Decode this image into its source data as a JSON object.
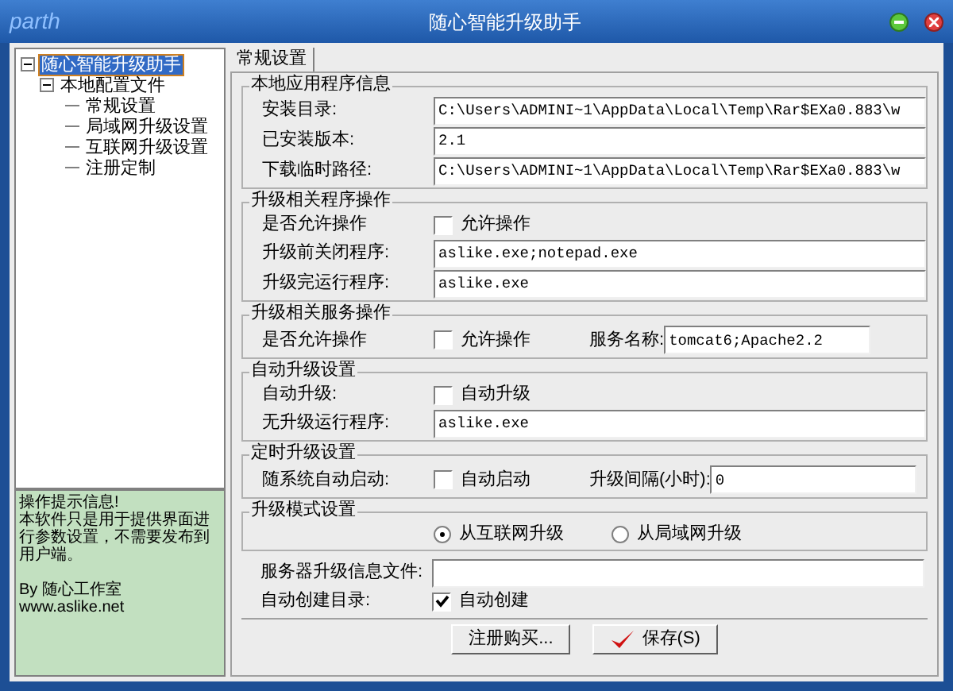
{
  "window": {
    "logo": "parth",
    "title": "随心智能升级助手"
  },
  "tree": [
    {
      "label": "随心智能升级助手",
      "selected": true,
      "expanded": true,
      "children": [
        {
          "label": "本地配置文件",
          "selected": false,
          "expanded": true,
          "children": [
            {
              "label": "常规设置",
              "selected": false
            },
            {
              "label": "局域网升级设置",
              "selected": false
            },
            {
              "label": "互联网升级设置",
              "selected": false
            },
            {
              "label": "注册定制",
              "selected": false
            }
          ]
        }
      ]
    }
  ],
  "tip": {
    "title": "操作提示信息!",
    "body": "本软件只是用于提供界面进行参数设置，不需要发布到用户端。",
    "author": "By 随心工作室",
    "site": "www.aslike.net"
  },
  "tabs": [
    {
      "label": "常规设置",
      "selected": true
    }
  ],
  "groups": [
    {
      "title": "本地应用程序信息",
      "rows": [
        {
          "kind": "field",
          "label": "安装目录:",
          "value": "C:\\Users\\ADMINI~1\\AppData\\Local\\Temp\\Rar$EXa0.883\\w"
        },
        {
          "kind": "field",
          "label": "已安装版本:",
          "value": "2.1"
        },
        {
          "kind": "field",
          "label": "下载临时路径:",
          "value": "C:\\Users\\ADMINI~1\\AppData\\Local\\Temp\\Rar$EXa0.883\\w"
        }
      ]
    },
    {
      "title": "升级相关程序操作",
      "rows": [
        {
          "kind": "checkbox",
          "label": "是否允许操作",
          "option": "允许操作",
          "checked": false
        },
        {
          "kind": "field",
          "label": "升级前关闭程序:",
          "value": "aslike.exe;notepad.exe"
        },
        {
          "kind": "field",
          "label": "升级完运行程序:",
          "value": "aslike.exe"
        }
      ]
    },
    {
      "title": "升级相关服务操作",
      "rows": [
        {
          "kind": "checkbox_field",
          "label": "是否允许操作",
          "option": "允许操作",
          "checked": false,
          "field_label": "服务名称:",
          "value": "tomcat6;Apache2.2"
        }
      ]
    },
    {
      "title": "自动升级设置",
      "rows": [
        {
          "kind": "checkbox",
          "label": "自动升级:",
          "option": "自动升级",
          "checked": false
        },
        {
          "kind": "field",
          "label": "无升级运行程序:",
          "value": "aslike.exe"
        }
      ]
    },
    {
      "title": "定时升级设置",
      "rows": [
        {
          "kind": "checkbox_field",
          "label": "随系统自动启动:",
          "option": "自动启动",
          "checked": false,
          "field_label": "升级间隔(小时):",
          "value": "0"
        }
      ]
    },
    {
      "title": "升级模式设置",
      "rows": [
        {
          "kind": "radios",
          "options": [
            {
              "label": "从互联网升级",
              "selected": true
            },
            {
              "label": "从局域网升级",
              "selected": false
            }
          ]
        }
      ]
    }
  ],
  "extra_rows": [
    {
      "kind": "field",
      "label": "服务器升级信息文件:",
      "value": ""
    },
    {
      "kind": "checkbox",
      "label": "自动创建目录:",
      "option": "自动创建",
      "checked": true
    }
  ],
  "buttons": [
    {
      "label": "注册购买...",
      "kind": "plain"
    },
    {
      "label": "保存(S)",
      "kind": "save"
    }
  ]
}
